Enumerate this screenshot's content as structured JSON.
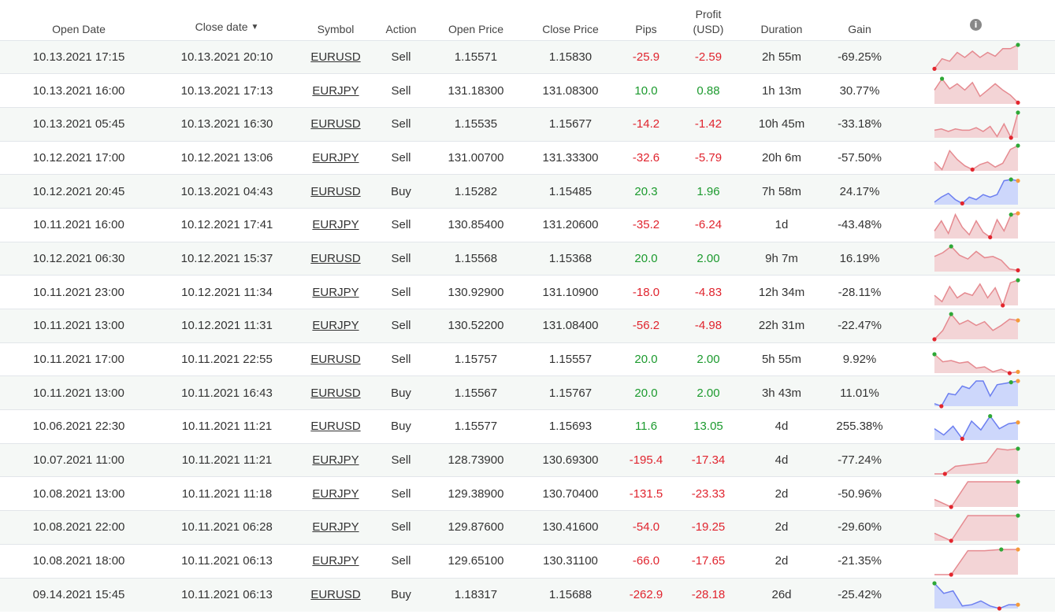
{
  "headers": {
    "open_date": "Open Date",
    "close_date": "Close date",
    "sort_arrow": "▼",
    "symbol": "Symbol",
    "action": "Action",
    "open_price": "Open Price",
    "close_price": "Close Price",
    "pips": "Pips",
    "profit_line1": "Profit",
    "profit_line2": "(USD)",
    "duration": "Duration",
    "gain": "Gain",
    "info_icon": "i"
  },
  "colors": {
    "positive": "#1c9a2e",
    "negative": "#e0242e",
    "sell_fill": "#f3d4d6",
    "sell_line": "#e58a90",
    "buy_fill": "#cdd7fb",
    "buy_line": "#6c7ff0",
    "marker_green": "#2ea836",
    "marker_red": "#e3262e",
    "marker_orange": "#f59a3a"
  },
  "rows": [
    {
      "open_date": "10.13.2021 17:15",
      "close_date": "10.13.2021 20:10",
      "symbol": "EURUSD",
      "action": "Sell",
      "open_price": "1.15571",
      "close_price": "1.15830",
      "pips": "-25.9",
      "profit": "-2.59",
      "duration": "2h 55m",
      "gain": "-69.25%",
      "spark": [
        0.05,
        0.45,
        0.35,
        0.7,
        0.5,
        0.75,
        0.5,
        0.7,
        0.55,
        0.85,
        0.85,
        1.0
      ],
      "spark_min": 0,
      "spark_max": 11
    },
    {
      "open_date": "10.13.2021 16:00",
      "close_date": "10.13.2021 17:13",
      "symbol": "EURJPY",
      "action": "Sell",
      "open_price": "131.18300",
      "close_price": "131.08300",
      "pips": "10.0",
      "profit": "0.88",
      "duration": "1h 13m",
      "gain": "30.77%",
      "spark": [
        0.55,
        1.0,
        0.6,
        0.8,
        0.55,
        0.85,
        0.3,
        0.55,
        0.8,
        0.55,
        0.35,
        0.05
      ],
      "spark_min": 11,
      "spark_max": 1
    },
    {
      "open_date": "10.13.2021 05:45",
      "close_date": "10.13.2021 16:30",
      "symbol": "EURUSD",
      "action": "Sell",
      "open_price": "1.15535",
      "close_price": "1.15677",
      "pips": "-14.2",
      "profit": "-1.42",
      "duration": "10h 45m",
      "gain": "-33.18%",
      "spark": [
        0.3,
        0.35,
        0.25,
        0.35,
        0.3,
        0.3,
        0.4,
        0.25,
        0.45,
        0.05,
        0.55,
        0.0,
        1.0
      ],
      "spark_min": 11,
      "spark_max": 12
    },
    {
      "open_date": "10.12.2021 17:00",
      "close_date": "10.12.2021 13:06",
      "symbol": "EURJPY",
      "action": "Sell",
      "open_price": "131.00700",
      "close_price": "131.33300",
      "pips": "-32.6",
      "profit": "-5.79",
      "duration": "20h 6m",
      "gain": "-57.50%",
      "spark": [
        0.35,
        0.05,
        0.8,
        0.45,
        0.2,
        0.05,
        0.25,
        0.35,
        0.15,
        0.3,
        0.85,
        1.0
      ],
      "spark_min": 5,
      "spark_max": 11
    },
    {
      "open_date": "10.12.2021 20:45",
      "close_date": "10.13.2021 04:43",
      "symbol": "EURUSD",
      "action": "Buy",
      "open_price": "1.15282",
      "close_price": "1.15485",
      "pips": "20.3",
      "profit": "1.96",
      "duration": "7h 58m",
      "gain": "24.17%",
      "spark": [
        0.1,
        0.3,
        0.45,
        0.2,
        0.05,
        0.3,
        0.2,
        0.4,
        0.3,
        0.4,
        0.95,
        1.0,
        0.95
      ],
      "spark_min": 4,
      "spark_max": 11,
      "spark_end": "orange"
    },
    {
      "open_date": "10.11.2021 16:00",
      "close_date": "10.12.2021 17:41",
      "symbol": "EURJPY",
      "action": "Sell",
      "open_price": "130.85400",
      "close_price": "131.20600",
      "pips": "-35.2",
      "profit": "-6.24",
      "duration": "1d",
      "gain": "-43.48%",
      "spark": [
        0.3,
        0.7,
        0.2,
        0.95,
        0.45,
        0.15,
        0.7,
        0.25,
        0.05,
        0.75,
        0.3,
        0.95,
        1.0
      ],
      "spark_min": 8,
      "spark_max": 11,
      "spark_end": "orange"
    },
    {
      "open_date": "10.12.2021 06:30",
      "close_date": "10.12.2021 15:37",
      "symbol": "EURUSD",
      "action": "Sell",
      "open_price": "1.15568",
      "close_price": "1.15368",
      "pips": "20.0",
      "profit": "2.00",
      "duration": "9h 7m",
      "gain": "16.19%",
      "spark": [
        0.6,
        0.75,
        1.0,
        0.65,
        0.5,
        0.8,
        0.55,
        0.6,
        0.45,
        0.1,
        0.05
      ],
      "spark_min": 10,
      "spark_max": 2
    },
    {
      "open_date": "10.11.2021 23:00",
      "close_date": "10.12.2021 11:34",
      "symbol": "EURJPY",
      "action": "Sell",
      "open_price": "130.92900",
      "close_price": "131.10900",
      "pips": "-18.0",
      "profit": "-4.83",
      "duration": "12h 34m",
      "gain": "-28.11%",
      "spark": [
        0.4,
        0.15,
        0.75,
        0.3,
        0.5,
        0.4,
        0.85,
        0.3,
        0.7,
        0.0,
        0.9,
        1.0
      ],
      "spark_min": 9,
      "spark_max": 11
    },
    {
      "open_date": "10.11.2021 13:00",
      "close_date": "10.12.2021 11:31",
      "symbol": "EURJPY",
      "action": "Sell",
      "open_price": "130.52200",
      "close_price": "131.08400",
      "pips": "-56.2",
      "profit": "-4.98",
      "duration": "22h 31m",
      "gain": "-22.47%",
      "spark": [
        0.0,
        0.35,
        1.0,
        0.6,
        0.75,
        0.55,
        0.7,
        0.35,
        0.55,
        0.8,
        0.75
      ],
      "spark_min": 0,
      "spark_max": 2,
      "spark_end": "orange"
    },
    {
      "open_date": "10.11.2021 17:00",
      "close_date": "10.11.2021 22:55",
      "symbol": "EURUSD",
      "action": "Sell",
      "open_price": "1.15757",
      "close_price": "1.15557",
      "pips": "20.0",
      "profit": "2.00",
      "duration": "5h 55m",
      "gain": "9.92%",
      "spark": [
        0.75,
        0.45,
        0.5,
        0.4,
        0.45,
        0.2,
        0.25,
        0.05,
        0.15,
        0.0,
        0.05
      ],
      "spark_min": 9,
      "spark_max": 0,
      "spark_end": "orange"
    },
    {
      "open_date": "10.11.2021 13:00",
      "close_date": "10.11.2021 16:43",
      "symbol": "EURUSD",
      "action": "Buy",
      "open_price": "1.15567",
      "close_price": "1.15767",
      "pips": "20.0",
      "profit": "2.00",
      "duration": "3h 43m",
      "gain": "11.01%",
      "spark": [
        0.1,
        0.0,
        0.5,
        0.45,
        0.8,
        0.7,
        1.0,
        1.0,
        0.4,
        0.85,
        0.9,
        0.95,
        1.0
      ],
      "spark_min": 1,
      "spark_max": 11,
      "spark_end": "orange"
    },
    {
      "open_date": "10.06.2021 22:30",
      "close_date": "10.11.2021 11:21",
      "symbol": "EURUSD",
      "action": "Buy",
      "open_price": "1.15577",
      "close_price": "1.15693",
      "pips": "11.6",
      "profit": "13.05",
      "duration": "4d",
      "gain": "255.38%",
      "spark": [
        0.45,
        0.2,
        0.55,
        0.05,
        0.75,
        0.4,
        0.95,
        0.45,
        0.65,
        0.7
      ],
      "spark_min": 3,
      "spark_max": 6,
      "spark_end": "orange"
    },
    {
      "open_date": "10.07.2021 11:00",
      "close_date": "10.11.2021 11:21",
      "symbol": "EURJPY",
      "action": "Sell",
      "open_price": "128.73900",
      "close_price": "130.69300",
      "pips": "-195.4",
      "profit": "-17.34",
      "duration": "4d",
      "gain": "-77.24%",
      "spark": [
        0.0,
        0.0,
        0.3,
        0.35,
        0.4,
        0.45,
        1.0,
        0.95,
        1.0
      ],
      "spark_min": 1,
      "spark_max": 8
    },
    {
      "open_date": "10.08.2021 13:00",
      "close_date": "10.11.2021 11:18",
      "symbol": "EURJPY",
      "action": "Sell",
      "open_price": "129.38900",
      "close_price": "130.70400",
      "pips": "-131.5",
      "profit": "-23.33",
      "duration": "2d",
      "gain": "-50.96%",
      "spark": [
        0.3,
        0.0,
        1.0,
        1.0,
        1.0,
        1.0
      ],
      "spark_min": 1,
      "spark_max": 5
    },
    {
      "open_date": "10.08.2021 22:00",
      "close_date": "10.11.2021 06:28",
      "symbol": "EURJPY",
      "action": "Sell",
      "open_price": "129.87600",
      "close_price": "130.41600",
      "pips": "-54.0",
      "profit": "-19.25",
      "duration": "2d",
      "gain": "-29.60%",
      "spark": [
        0.3,
        0.0,
        1.0,
        1.0,
        1.0,
        1.0
      ],
      "spark_min": 1,
      "spark_max": 5
    },
    {
      "open_date": "10.08.2021 18:00",
      "close_date": "10.11.2021 06:13",
      "symbol": "EURJPY",
      "action": "Sell",
      "open_price": "129.65100",
      "close_price": "130.31100",
      "pips": "-66.0",
      "profit": "-17.65",
      "duration": "2d",
      "gain": "-21.35%",
      "spark": [
        0.0,
        0.0,
        0.95,
        0.95,
        1.0,
        1.0
      ],
      "spark_min": 1,
      "spark_max": 4,
      "spark_end": "orange"
    },
    {
      "open_date": "09.14.2021 15:45",
      "close_date": "10.11.2021 06:13",
      "symbol": "EURUSD",
      "action": "Buy",
      "open_price": "1.18317",
      "close_price": "1.15688",
      "pips": "-262.9",
      "profit": "-28.18",
      "duration": "26d",
      "gain": "-25.42%",
      "spark": [
        1.0,
        0.6,
        0.7,
        0.1,
        0.15,
        0.3,
        0.1,
        0.0,
        0.15,
        0.15
      ],
      "spark_min": 7,
      "spark_max": 0,
      "spark_end": "orange"
    }
  ]
}
